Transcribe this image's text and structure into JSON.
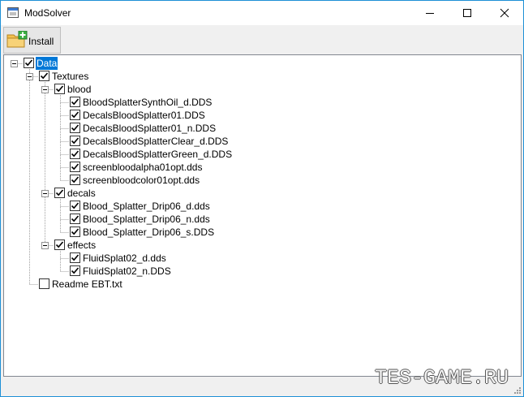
{
  "window": {
    "title": "ModSolver",
    "controls": [
      "minimize",
      "maximize",
      "close"
    ]
  },
  "toolbar": {
    "install_label": "Install",
    "install_icon": "folder-add-icon"
  },
  "tree": {
    "nodes": [
      {
        "label": "Data",
        "level": 0,
        "checked": true,
        "expanded": true,
        "selected": true
      },
      {
        "label": "Textures",
        "level": 1,
        "checked": true,
        "expanded": true
      },
      {
        "label": "blood",
        "level": 2,
        "checked": true,
        "expanded": true
      },
      {
        "label": "BloodSplatterSynthOil_d.DDS",
        "level": 3,
        "checked": true
      },
      {
        "label": "DecalsBloodSplatter01.DDS",
        "level": 3,
        "checked": true
      },
      {
        "label": "DecalsBloodSplatter01_n.DDS",
        "level": 3,
        "checked": true
      },
      {
        "label": "DecalsBloodSplatterClear_d.DDS",
        "level": 3,
        "checked": true
      },
      {
        "label": "DecalsBloodSplatterGreen_d.DDS",
        "level": 3,
        "checked": true
      },
      {
        "label": "screenbloodalpha01opt.dds",
        "level": 3,
        "checked": true
      },
      {
        "label": "screenbloodcolor01opt.dds",
        "level": 3,
        "checked": true
      },
      {
        "label": "decals",
        "level": 2,
        "checked": true,
        "expanded": true
      },
      {
        "label": "Blood_Splatter_Drip06_d.dds",
        "level": 3,
        "checked": true
      },
      {
        "label": "Blood_Splatter_Drip06_n.dds",
        "level": 3,
        "checked": true
      },
      {
        "label": "Blood_Splatter_Drip06_s.DDS",
        "level": 3,
        "checked": true
      },
      {
        "label": "effects",
        "level": 2,
        "checked": true,
        "expanded": true
      },
      {
        "label": "FluidSplat02_d.dds",
        "level": 3,
        "checked": true
      },
      {
        "label": "FluidSplat02_n.DDS",
        "level": 3,
        "checked": true
      },
      {
        "label": "Readme EBT.txt",
        "level": 1,
        "checked": false
      }
    ]
  },
  "watermark": "TES-GAME.RU",
  "colors": {
    "selection": "#0078d7",
    "border": "#1e90d6"
  }
}
